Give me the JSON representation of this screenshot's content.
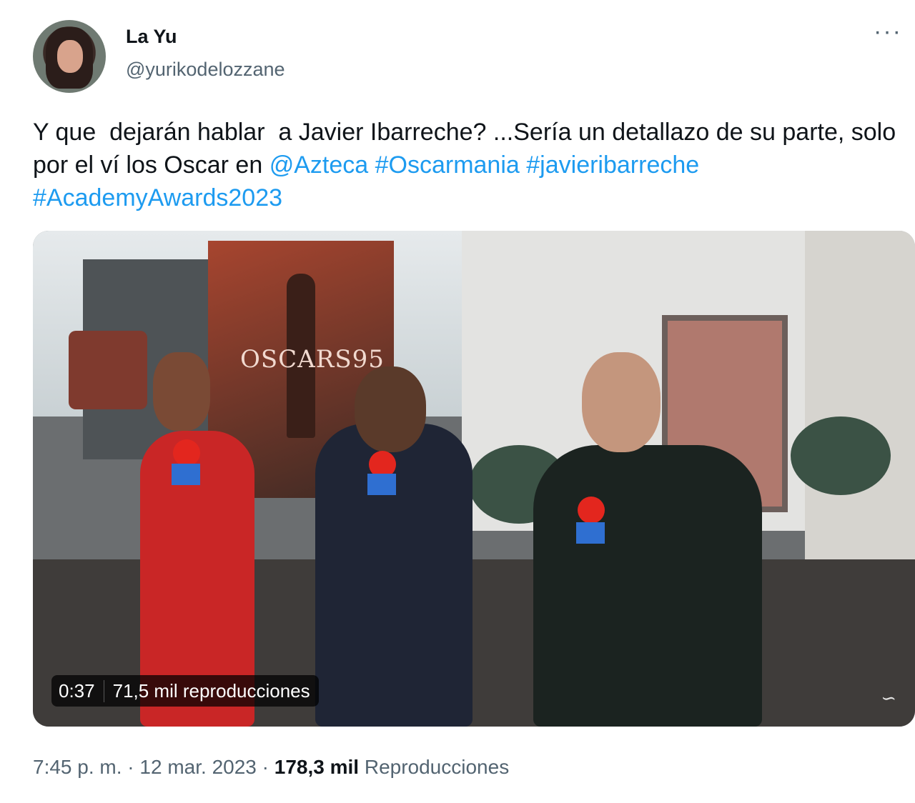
{
  "author": {
    "display_name": "La Yu",
    "handle": "@yurikodelozzane"
  },
  "more_label": "···",
  "tweet": {
    "text_plain": "Y que  dejarán hablar  a Javier Ibarreche? ...Sería un detallazo de su parte, solo por el ví los Oscar en ",
    "mention": "@Azteca",
    "hashtag_1": "#Oscarmania",
    "hashtag_2": "#javieribarreche",
    "hashtag_3": "#AcademyAwards2023"
  },
  "video": {
    "poster_text": "OSCARS95",
    "duration": "0:37",
    "views": "71,5 mil reproducciones",
    "watermark": "∽"
  },
  "meta": {
    "time": "7:45 p. m.",
    "separator": "·",
    "date": "12 mar. 2023",
    "view_count": "178,3 mil",
    "view_label": "Reproducciones"
  }
}
